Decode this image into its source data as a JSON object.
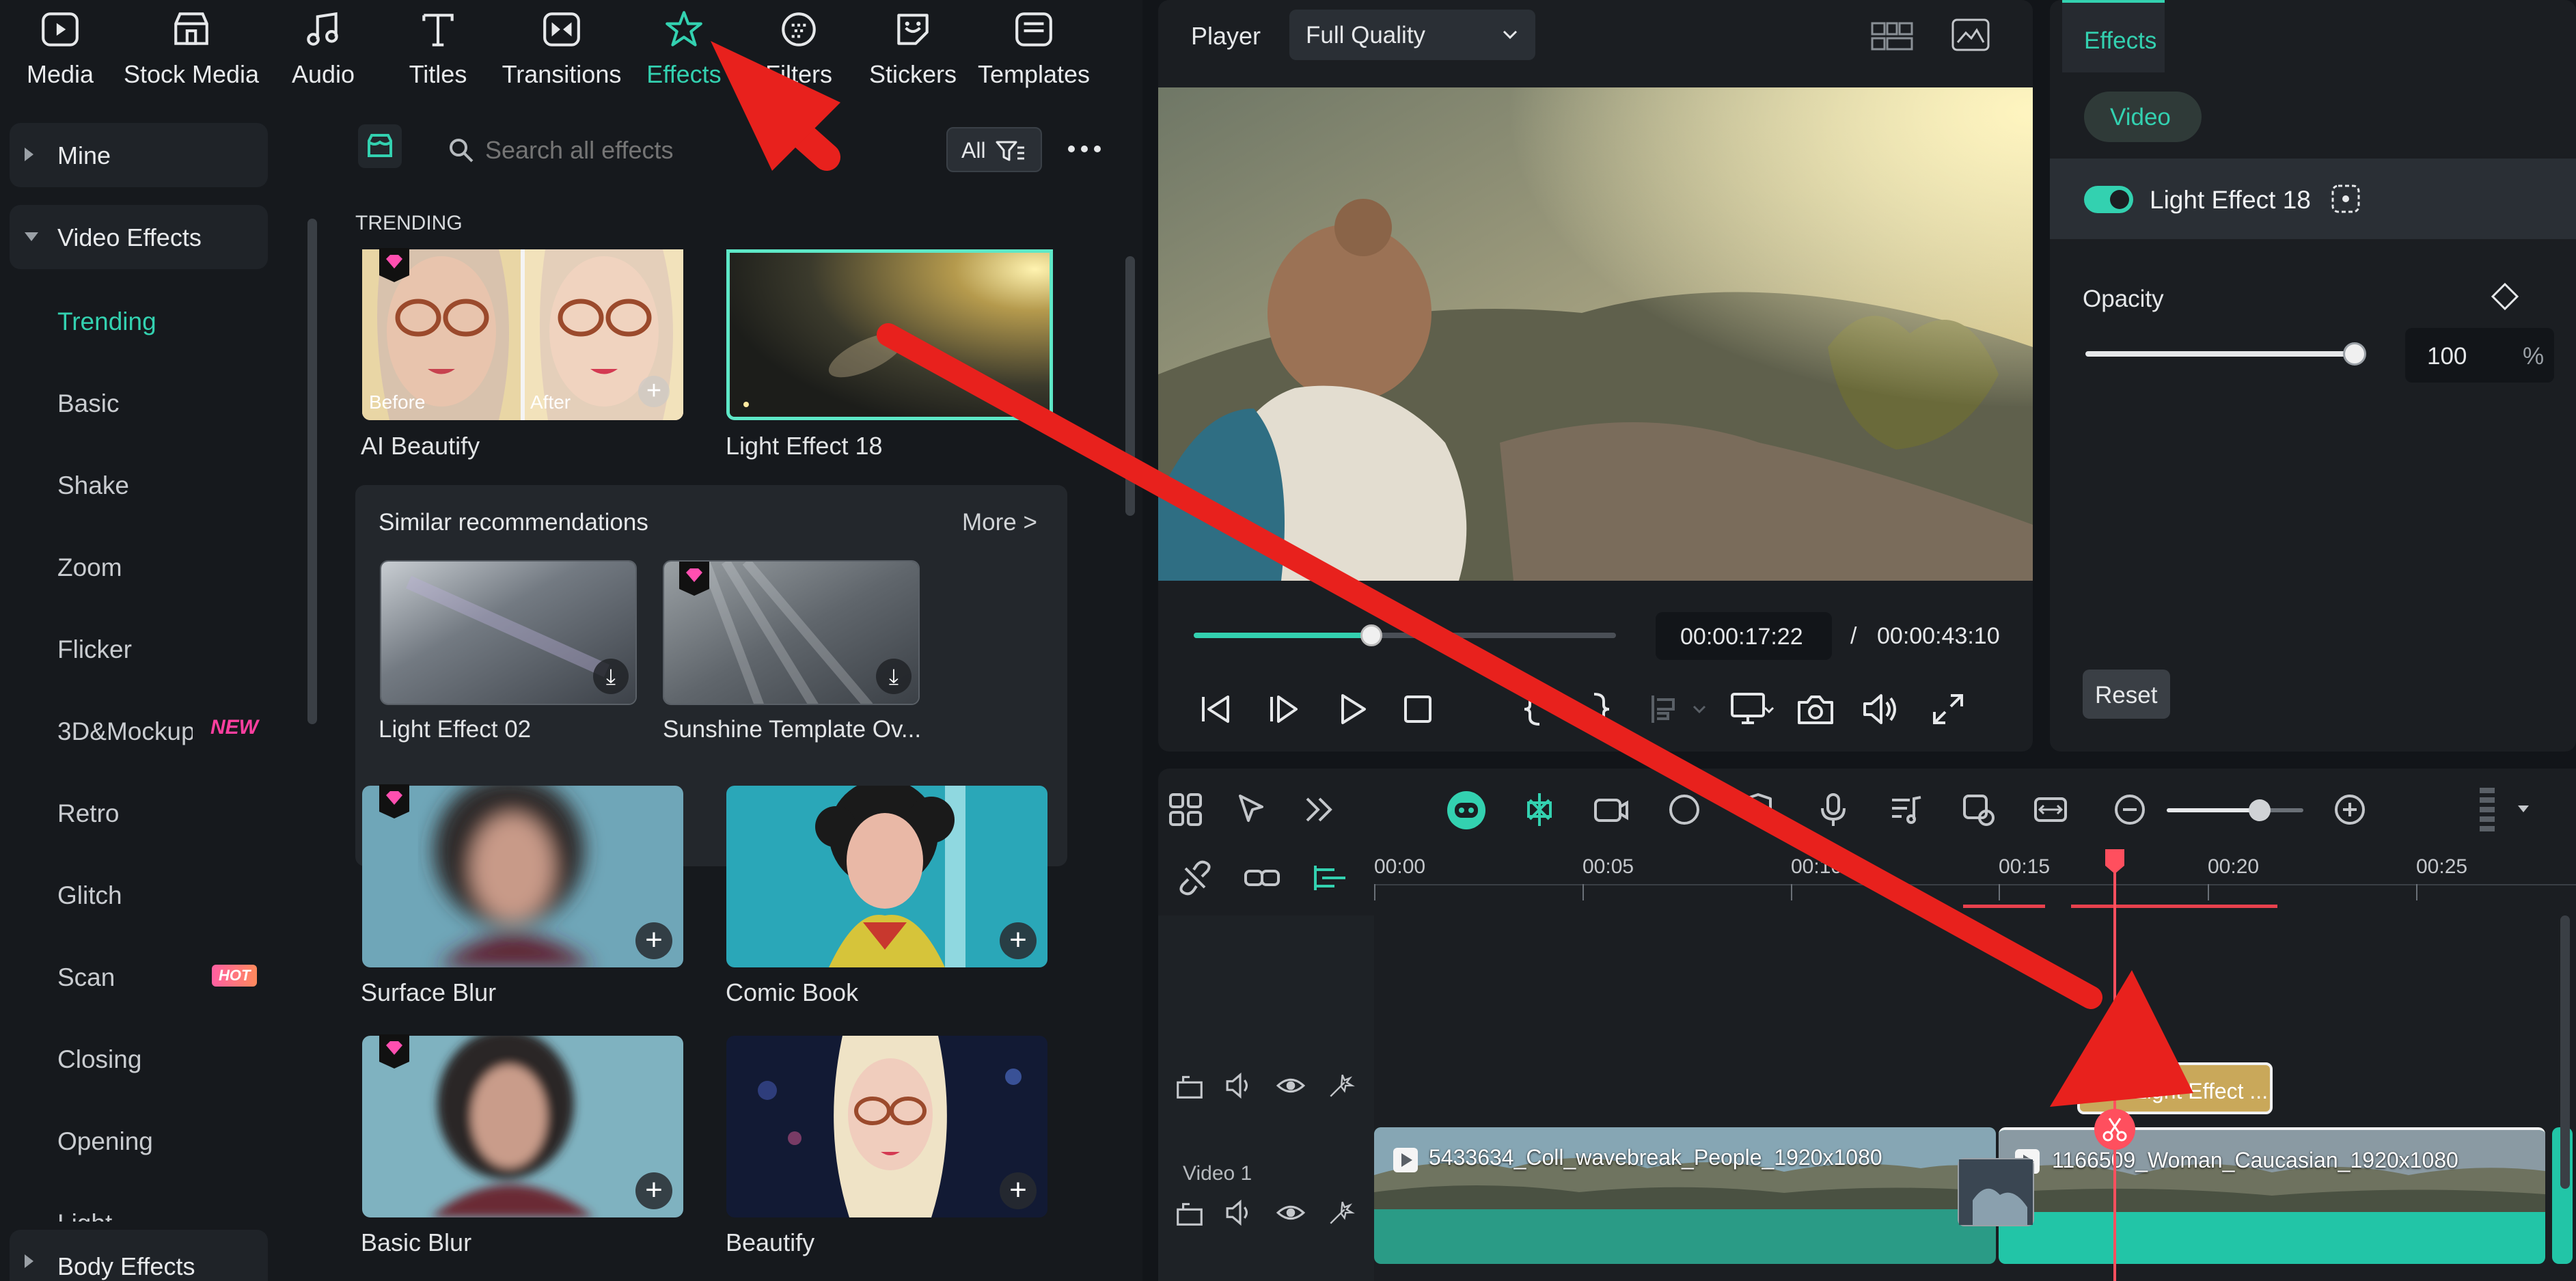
{
  "toolbar": {
    "tabs": [
      {
        "label": "Media",
        "icon": "media-icon"
      },
      {
        "label": "Stock Media",
        "icon": "stock-media-icon"
      },
      {
        "label": "Audio",
        "icon": "audio-icon"
      },
      {
        "label": "Titles",
        "icon": "titles-icon"
      },
      {
        "label": "Transitions",
        "icon": "transitions-icon"
      },
      {
        "label": "Effects",
        "icon": "effects-icon",
        "active": true
      },
      {
        "label": "Filters",
        "icon": "filters-icon"
      },
      {
        "label": "Stickers",
        "icon": "stickers-icon"
      },
      {
        "label": "Templates",
        "icon": "templates-icon"
      }
    ]
  },
  "sidebar": {
    "mine": "Mine",
    "video_effects": "Video Effects",
    "items": [
      {
        "label": "Trending",
        "active": true
      },
      {
        "label": "Basic"
      },
      {
        "label": "Shake"
      },
      {
        "label": "Zoom"
      },
      {
        "label": "Flicker"
      },
      {
        "label": "3D&Mockup",
        "badge": "NEW"
      },
      {
        "label": "Retro"
      },
      {
        "label": "Glitch"
      },
      {
        "label": "Scan",
        "badge": "HOT"
      },
      {
        "label": "Closing"
      },
      {
        "label": "Opening"
      },
      {
        "label": "Light"
      }
    ],
    "body_effects": "Body Effects"
  },
  "browser": {
    "search_placeholder": "Search all effects",
    "filter_label": "All",
    "section_title": "TRENDING",
    "before_label": "Before",
    "after_label": "After",
    "cards_top": [
      "AI Beautify",
      "Light Effect 18"
    ],
    "similar_title": "Similar recommendations",
    "more_label": "More >",
    "similar_cards": [
      "Light Effect 02",
      "Sunshine Template Ov..."
    ],
    "cards_bottom": [
      "Surface Blur",
      "Comic Book",
      "Basic Blur",
      "Beautify"
    ]
  },
  "player": {
    "label": "Player",
    "quality": "Full Quality",
    "current_time": "00:00:17:22",
    "separator": "/",
    "total_time": "00:00:43:10",
    "progress": 0.42
  },
  "properties": {
    "tab": "Effects",
    "category": "Video",
    "effect_name": "Light Effect 18",
    "opacity_label": "Opacity",
    "opacity_value": "100",
    "opacity_unit": "%",
    "reset_label": "Reset"
  },
  "timeline": {
    "ruler": [
      "00:00",
      "00:05",
      "00:10",
      "00:15",
      "00:20",
      "00:25"
    ],
    "effect_clip": "Light Effect ...",
    "track_label": "Video 1",
    "clip1": "5433634_Coll_wavebreak_People_1920x1080",
    "clip2": "1166509_Woman_Caucasian_1920x1080",
    "zoom": 0.68
  },
  "colors": {
    "accent": "#33d1b0",
    "annotation": "#e8211d",
    "playhead": "#ff4f5e",
    "effect_clip": "#c9a85a"
  }
}
